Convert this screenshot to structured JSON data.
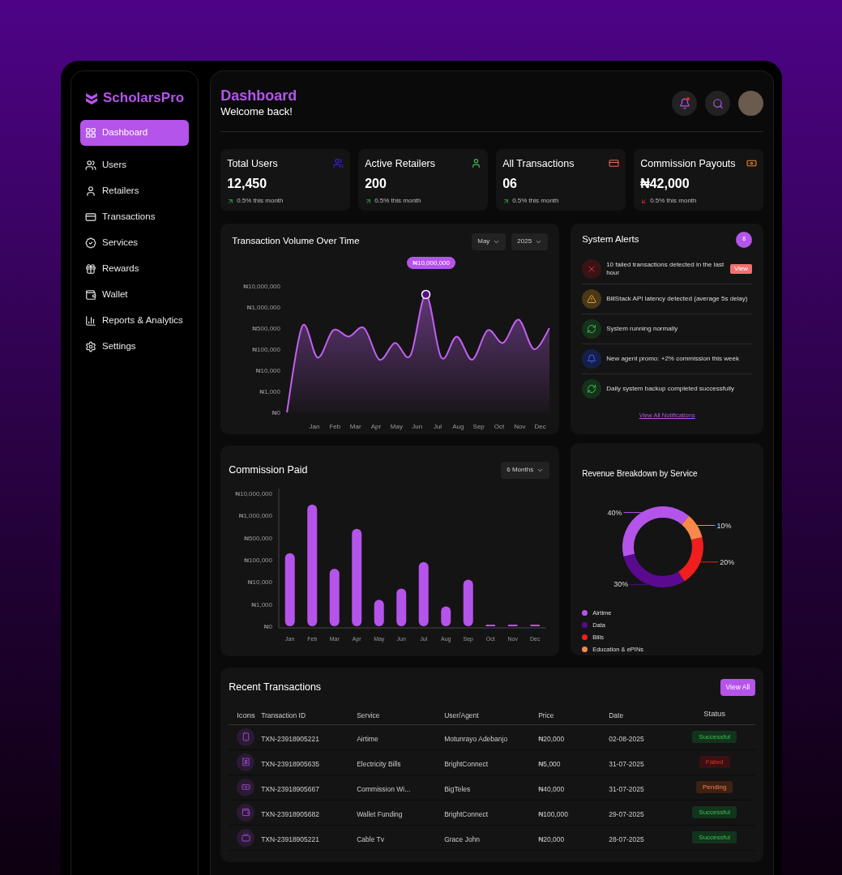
{
  "sidebar": {
    "brand": "ScholarsPro",
    "items": [
      {
        "label": "Dashboard",
        "selected": true
      },
      {
        "label": "Users",
        "selected": false
      },
      {
        "label": "Retailers",
        "selected": false
      },
      {
        "label": "Transactions",
        "selected": false
      },
      {
        "label": "Services",
        "selected": false
      },
      {
        "label": "Rewards",
        "selected": false
      },
      {
        "label": "Wallet",
        "selected": false
      },
      {
        "label": "Reports & Analytics",
        "selected": false
      },
      {
        "label": "Settings",
        "selected": false
      }
    ]
  },
  "header": {
    "title": "Dashboard",
    "subtitle": "Welcome back!",
    "notifications_unread": true
  },
  "stats": [
    {
      "label": "Total Users",
      "value": "12,450",
      "rising": true,
      "change": "0.5% this month"
    },
    {
      "label": "Active Retailers",
      "value": "200",
      "rising": true,
      "change": "0.5% this month"
    },
    {
      "label": "All Transactions",
      "value": "06",
      "rising": true,
      "change": "0.5% this month"
    },
    {
      "label": "Commission Payouts",
      "value": "₦42,000",
      "rising": false,
      "change": "0.5% this month"
    }
  ],
  "volume_chart": {
    "title": "Transaction Volume Over Time",
    "filters": [
      "May",
      "2025"
    ],
    "tooltip": "₦10,000,000",
    "y_labels": [
      "₦10,000,000",
      "₦1,000,000",
      "₦500,000",
      "₦100,000",
      "₦10,000",
      "₦1,000",
      "₦0"
    ],
    "x_labels": [
      "Jan",
      "Feb",
      "Mar",
      "Apr",
      "May",
      "Jun",
      "Jul",
      "Aug",
      "Sep",
      "Oct",
      "Nov",
      "Dec"
    ]
  },
  "alerts": {
    "title": "System Alerts",
    "count": "8",
    "items": [
      {
        "kind": "error",
        "text": "10 failed transactions detected in the last hour",
        "action": "View"
      },
      {
        "kind": "warning",
        "text": "BillStack API latency detected (average 5s delay)"
      },
      {
        "kind": "success",
        "text": "System running normally"
      },
      {
        "kind": "info",
        "text": "New agent promo: +2% commission this week"
      },
      {
        "kind": "success",
        "text": "Daily system backup completed successfully"
      }
    ],
    "link": "View All Notifications"
  },
  "commission_chart": {
    "title": "Commission Paid",
    "filter": "6 Months",
    "y_labels": [
      "₦10,000,000",
      "₦1,000,000",
      "₦500,000",
      "₦100,000",
      "₦10,000",
      "₦1,000",
      "₦0"
    ],
    "x_labels": [
      "Jan",
      "Feb",
      "Mar",
      "Apr",
      "May",
      "Jun",
      "Jul",
      "Aug",
      "Sep",
      "Oct",
      "Nov",
      "Dec"
    ]
  },
  "revenue_chart": {
    "title": "Revenue Breakdown by Service",
    "chart_data": {
      "type": "donut",
      "categories": [
        "Airtime",
        "Data",
        "Bills",
        "Education & ePINs"
      ],
      "values": [
        40,
        30,
        20,
        10
      ],
      "value_labels": [
        "40%",
        "30%",
        "20%",
        "10%"
      ],
      "colors": [
        "#b554ea",
        "#5a0a8f",
        "#f01e1e",
        "#f7894a"
      ]
    }
  },
  "transactions": {
    "title": "Recent Transactions",
    "action": "View All",
    "columns": [
      "Icons",
      "Transaction ID",
      "Service",
      "User/Agent",
      "Price",
      "Date",
      "Status"
    ],
    "rows": [
      {
        "kind": "phone",
        "id": "TXN-23918905221",
        "service": "Airtime",
        "user": "Motunrayo Adebanjo",
        "price": "₦20,000",
        "date": "02-08-2025",
        "status": {
          "label": "Successful",
          "kind": "success"
        }
      },
      {
        "kind": "bill",
        "id": "TXN-23918905635",
        "service": "Electricity Bills",
        "user": "BrightConnect",
        "price": "₦5,000",
        "date": "31-07-2025",
        "status": {
          "label": "Failed",
          "kind": "failed"
        }
      },
      {
        "kind": "moneybag",
        "id": "TXN-23918905667",
        "service": "Commission Wi...",
        "user": "BigTeles",
        "price": "₦40,000",
        "date": "31-07-2025",
        "status": {
          "label": "Pending",
          "kind": "pending"
        }
      },
      {
        "kind": "wallet",
        "id": "TXN-23918905682",
        "service": "Wallet Funding",
        "user": "BrightConnect",
        "price": "₦100,000",
        "date": "29-07-2025",
        "status": {
          "label": "Successful",
          "kind": "success"
        }
      },
      {
        "kind": "tv",
        "id": "TXN-23918905221",
        "service": "Cable Tv",
        "user": "Grace John",
        "price": "₦20,000",
        "date": "28-07-2025",
        "status": {
          "label": "Successful",
          "kind": "success"
        }
      }
    ]
  }
}
